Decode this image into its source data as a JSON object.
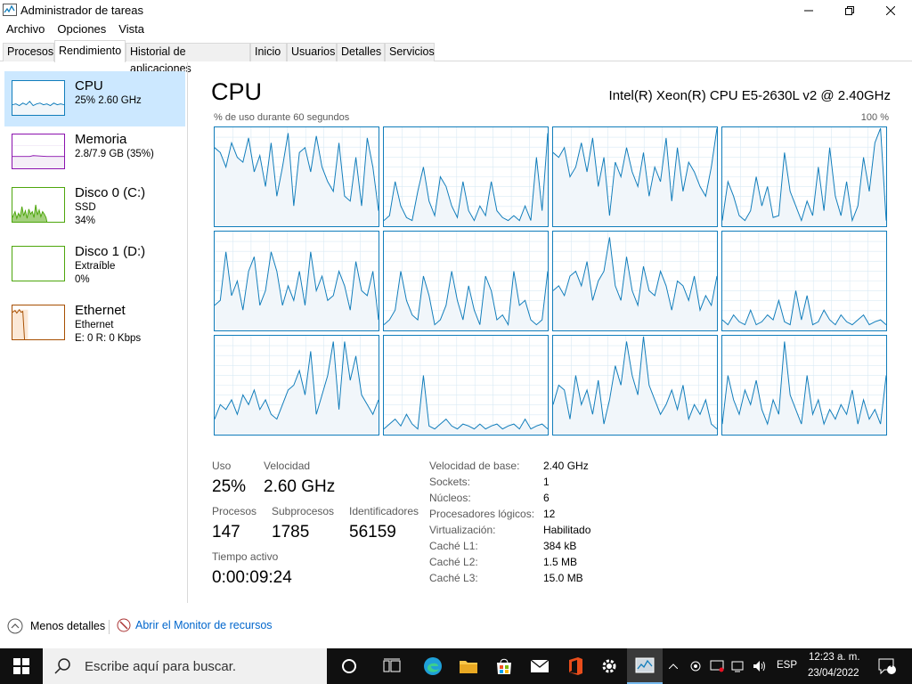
{
  "window": {
    "title": "Administrador de tareas"
  },
  "menu": [
    "Archivo",
    "Opciones",
    "Vista"
  ],
  "tabs": [
    "Procesos",
    "Rendimiento",
    "Historial de aplicaciones",
    "Inicio",
    "Usuarios",
    "Detalles",
    "Servicios"
  ],
  "sidebar": {
    "items": [
      {
        "title": "CPU",
        "lines": [
          "25%  2.60 GHz"
        ],
        "color": "#117dbb"
      },
      {
        "title": "Memoria",
        "lines": [
          "2.8/7.9 GB (35%)"
        ],
        "color": "#8b12ae"
      },
      {
        "title": "Disco 0 (C:)",
        "lines": [
          "SSD",
          "34%"
        ],
        "color": "#4da60c"
      },
      {
        "title": "Disco 1 (D:)",
        "lines": [
          "Extraíble",
          "0%"
        ],
        "color": "#4da60c"
      },
      {
        "title": "Ethernet",
        "lines": [
          "Ethernet",
          "E: 0  R: 0 Kbps"
        ],
        "color": "#a74f01"
      }
    ]
  },
  "main": {
    "title": "CPU",
    "model": "Intel(R) Xeon(R) CPU E5-2630L v2 @ 2.40GHz",
    "usage_label": "% de uso durante 60 segundos",
    "usage_max": "100 %"
  },
  "stats": {
    "uso_label": "Uso",
    "uso": "25%",
    "velocidad_label": "Velocidad",
    "velocidad": "2.60 GHz",
    "procesos_label": "Procesos",
    "procesos": "147",
    "subprocesos_label": "Subprocesos",
    "subprocesos": "1785",
    "identificadores_label": "Identificadores",
    "identificadores": "56159",
    "tiempo_label": "Tiempo activo",
    "tiempo": "0:00:09:24"
  },
  "specs": [
    {
      "k": "Velocidad de base:",
      "v": "2.40 GHz"
    },
    {
      "k": "Sockets:",
      "v": "1"
    },
    {
      "k": "Núcleos:",
      "v": "6"
    },
    {
      "k": "Procesadores lógicos:",
      "v": "12"
    },
    {
      "k": "Virtualización:",
      "v": "Habilitado"
    },
    {
      "k": "Caché L1:",
      "v": "384 kB"
    },
    {
      "k": "Caché L2:",
      "v": "1.5 MB"
    },
    {
      "k": "Caché L3:",
      "v": "15.0 MB"
    }
  ],
  "bottom": {
    "less_details": "Menos detalles",
    "resource_monitor": "Abrir el Monitor de recursos"
  },
  "taskbar": {
    "search_placeholder": "Escribe aquí para buscar.",
    "lang": "ESP",
    "time": "12:23 a. m.",
    "date": "23/04/2022",
    "notifications": "4"
  },
  "chart_data": {
    "type": "area",
    "title": "% de uso durante 60 segundos",
    "ylim": [
      0,
      100
    ],
    "series": [
      {
        "values": [
          80,
          75,
          60,
          85,
          70,
          65,
          90,
          55,
          72,
          40,
          85,
          30,
          60,
          95,
          20,
          75,
          80,
          55,
          92,
          60,
          45,
          35,
          85,
          30,
          25,
          70,
          20,
          90,
          60,
          15
        ]
      },
      {
        "values": [
          5,
          10,
          45,
          20,
          8,
          5,
          35,
          60,
          25,
          10,
          50,
          40,
          20,
          8,
          45,
          15,
          5,
          20,
          10,
          45,
          15,
          8,
          5,
          10,
          5,
          20,
          5,
          70,
          15,
          95
        ]
      },
      {
        "values": [
          75,
          70,
          80,
          50,
          60,
          85,
          55,
          90,
          40,
          70,
          10,
          65,
          50,
          80,
          55,
          40,
          75,
          30,
          60,
          45,
          90,
          25,
          80,
          35,
          65,
          55,
          40,
          30,
          60,
          100
        ]
      },
      {
        "values": [
          5,
          45,
          30,
          10,
          5,
          15,
          50,
          20,
          40,
          8,
          10,
          75,
          35,
          20,
          5,
          25,
          10,
          60,
          15,
          80,
          30,
          10,
          45,
          5,
          20,
          70,
          35,
          85,
          100,
          5
        ]
      },
      {
        "values": [
          25,
          30,
          80,
          35,
          50,
          20,
          60,
          75,
          25,
          40,
          80,
          60,
          25,
          45,
          30,
          60,
          25,
          80,
          40,
          55,
          30,
          35,
          60,
          45,
          20,
          70,
          40,
          35,
          60,
          10
        ]
      },
      {
        "values": [
          5,
          10,
          20,
          60,
          30,
          15,
          10,
          55,
          35,
          5,
          10,
          25,
          60,
          30,
          10,
          45,
          20,
          5,
          55,
          40,
          10,
          15,
          5,
          60,
          25,
          30,
          10,
          5,
          10,
          60
        ]
      },
      {
        "values": [
          40,
          45,
          35,
          55,
          60,
          45,
          70,
          30,
          50,
          60,
          95,
          45,
          30,
          75,
          40,
          25,
          65,
          40,
          35,
          60,
          45,
          20,
          50,
          45,
          30,
          55,
          20,
          35,
          25,
          55
        ]
      },
      {
        "values": [
          10,
          5,
          15,
          8,
          5,
          20,
          5,
          8,
          15,
          10,
          30,
          8,
          5,
          40,
          10,
          35,
          5,
          8,
          20,
          10,
          5,
          15,
          8,
          5,
          10,
          15,
          5,
          8,
          10,
          5
        ]
      },
      {
        "values": [
          15,
          30,
          25,
          35,
          20,
          40,
          30,
          45,
          25,
          35,
          20,
          15,
          30,
          45,
          50,
          65,
          40,
          85,
          20,
          40,
          60,
          95,
          25,
          95,
          55,
          80,
          40,
          30,
          20,
          35
        ]
      },
      {
        "values": [
          5,
          10,
          15,
          8,
          20,
          10,
          5,
          60,
          8,
          5,
          10,
          15,
          8,
          5,
          10,
          8,
          5,
          10,
          5,
          8,
          10,
          5,
          8,
          10,
          5,
          15,
          5,
          8,
          10,
          5
        ]
      },
      {
        "values": [
          30,
          50,
          45,
          15,
          60,
          30,
          45,
          20,
          55,
          10,
          35,
          70,
          50,
          95,
          60,
          40,
          100,
          50,
          35,
          20,
          30,
          45,
          25,
          50,
          15,
          30,
          20,
          35,
          10,
          5
        ]
      },
      {
        "values": [
          10,
          60,
          35,
          20,
          45,
          30,
          55,
          25,
          10,
          35,
          20,
          95,
          40,
          25,
          10,
          60,
          20,
          35,
          10,
          25,
          15,
          30,
          20,
          45,
          10,
          35,
          15,
          25,
          10,
          60
        ]
      }
    ]
  }
}
